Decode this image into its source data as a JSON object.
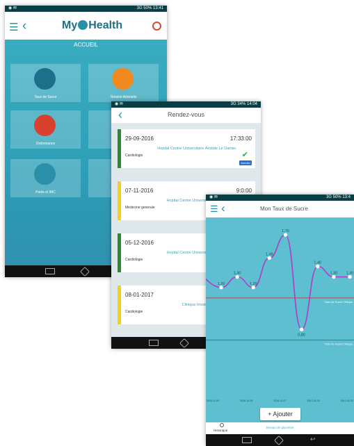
{
  "screen1": {
    "status_time": "13:41",
    "status_right": "3G 50%",
    "logo_my": "My",
    "logo_health": "Health",
    "title": "ACCUEIL",
    "tiles": [
      {
        "label": "Taux de Sucre",
        "color": "#1d6f8a"
      },
      {
        "label": "Tension Arterielle",
        "color": "#f08a1e"
      },
      {
        "label": "Ordonnance",
        "color": "#d9412f"
      },
      {
        "label": "",
        "color": "#1a6fd0"
      },
      {
        "label": "Poids et IMC",
        "color": "#2a8fa9"
      },
      {
        "label": "",
        "color": "#1a6fd0"
      }
    ]
  },
  "screen2": {
    "status_time": "14:04",
    "status_right": "3G 34%",
    "title": "Rendez-vous",
    "cards": [
      {
        "date": "29-09-2016",
        "time": "17:33:00",
        "hospital": "Hopital Centre Universitaire Aristide Le Dantec",
        "specialty": "Cardiologie",
        "cancel": "Annuler",
        "color": "green"
      },
      {
        "date": "07-11-2016",
        "time": "9:0:00",
        "hospital": "Hopital Centre Universitaire Aristide",
        "specialty": "Medecine generale",
        "color": "yellow"
      },
      {
        "date": "05-12-2016",
        "time": "",
        "hospital": "Hopital Centre Universitaire Aristide",
        "specialty": "Cardiologie",
        "color": "green"
      },
      {
        "date": "08-01-2017",
        "time": "",
        "hospital": "Clinique Imodoan",
        "specialty": "Cardiologie",
        "color": "yellow"
      }
    ]
  },
  "screen3": {
    "status_time": "13:4",
    "status_right": "3G 50%",
    "title": "Mon Taux de Sucre",
    "add_button": "Ajouter",
    "history_label": "Historique",
    "level_label": "Niveau de glycémie",
    "chart_data": {
      "type": "line",
      "x": [
        "2016-10-04",
        "2016-10-26",
        "2016-12-07",
        "2017-01-21",
        "2017-01-22"
      ],
      "values": [
        1.2,
        1.3,
        1.2,
        1.48,
        1.7,
        0.8,
        1.4,
        1.3,
        1.3
      ],
      "labels": [
        "1,20",
        "1,30",
        "1,20",
        "1,48",
        "1,70",
        "0,80",
        "1,40",
        "1,30",
        "1,30"
      ],
      "ref_lines": [
        {
          "name": "Taux de Sucre Critique",
          "value": 1.1
        },
        {
          "name": "Taux de Sucre Critique",
          "value": 0.7
        }
      ],
      "ylim": [
        0.2,
        1.8
      ],
      "line_color": "#b03cc9",
      "ref_color": "#d42424"
    }
  }
}
